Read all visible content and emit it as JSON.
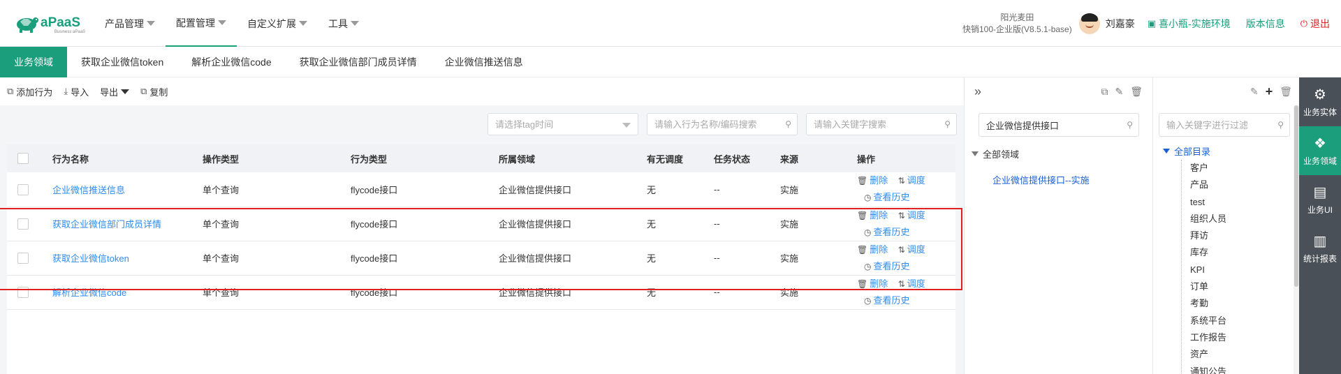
{
  "header": {
    "logo_text": "aPaaS",
    "logo_sub": "Business aPaaS",
    "nav": [
      {
        "label": "产品管理"
      },
      {
        "label": "配置管理"
      },
      {
        "label": "自定义扩展"
      },
      {
        "label": "工具"
      }
    ],
    "company_name": "阳光麦田",
    "company_version": "快销100-企业版(V8.5.1-base)",
    "username": "刘嘉豪",
    "env_link": "喜小瓶-实施环境",
    "version_link": "版本信息",
    "logout": "退出"
  },
  "tabs": [
    "业务领域",
    "获取企业微信token",
    "解析企业微信code",
    "获取企业微信部门成员详情",
    "企业微信推送信息"
  ],
  "toolbar": {
    "add": "添加行为",
    "import": "导入",
    "export": "导出",
    "copy": "复制"
  },
  "filters": {
    "tag_time": "请选择tag时间",
    "name_search": "请输入行为名称/编码搜索",
    "keyword_search": "请输入关键字搜索"
  },
  "table": {
    "headers": [
      "行为名称",
      "操作类型",
      "行为类型",
      "所属领域",
      "有无调度",
      "任务状态",
      "来源",
      "操作"
    ],
    "rows": [
      {
        "name": "企业微信推送信息",
        "op_type": "单个查询",
        "act_type": "flycode接口",
        "domain": "企业微信提供接口",
        "schedule": "无",
        "status": "--",
        "source": "实施"
      },
      {
        "name": "获取企业微信部门成员详情",
        "op_type": "单个查询",
        "act_type": "flycode接口",
        "domain": "企业微信提供接口",
        "schedule": "无",
        "status": "--",
        "source": "实施"
      },
      {
        "name": "获取企业微信token",
        "op_type": "单个查询",
        "act_type": "flycode接口",
        "domain": "企业微信提供接口",
        "schedule": "无",
        "status": "--",
        "source": "实施"
      },
      {
        "name": "解析企业微信code",
        "op_type": "单个查询",
        "act_type": "flycode接口",
        "domain": "企业微信提供接口",
        "schedule": "无",
        "status": "--",
        "source": "实施"
      }
    ],
    "ops": {
      "delete": "删除",
      "schedule": "调度",
      "history": "查看历史"
    }
  },
  "middle_panel": {
    "search_value": "企业微信提供接口",
    "tree_root": "全部领域",
    "tree_child": "企业微信提供接口--实施"
  },
  "dir_panel": {
    "placeholder": "输入关键字进行过滤",
    "root": "全部目录",
    "items": [
      "客户",
      "产品",
      "test",
      "组织人员",
      "拜访",
      "库存",
      "KPI",
      "订单",
      "考勤",
      "系统平台",
      "工作报告",
      "资产",
      "通知公告"
    ]
  },
  "sidebar": [
    {
      "label": "业务实体",
      "icon": "gear-doc-icon"
    },
    {
      "label": "业务领域",
      "icon": "cubes-icon"
    },
    {
      "label": "业务UI",
      "icon": "ui-doc-icon"
    },
    {
      "label": "统计报表",
      "icon": "bar-chart-icon"
    }
  ],
  "colors": {
    "accent": "#1a9e7c",
    "link": "#2d8cf0",
    "highlight": "#e02020",
    "sidebar": "#4a5057"
  }
}
